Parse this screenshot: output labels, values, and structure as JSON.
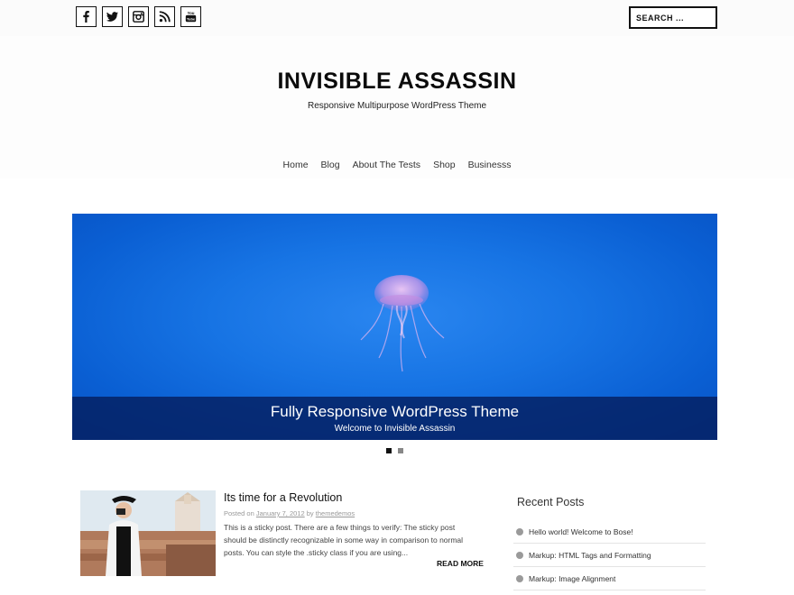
{
  "social": [
    {
      "icon": "facebook-icon",
      "glyph": "f"
    },
    {
      "icon": "twitter-icon",
      "glyph": "t"
    },
    {
      "icon": "instagram-icon",
      "glyph": "i"
    },
    {
      "icon": "rss-icon",
      "glyph": "r"
    },
    {
      "icon": "youtube-icon",
      "glyph": "y"
    }
  ],
  "search": {
    "placeholder": "SEARCH ..."
  },
  "site": {
    "title": "INVISIBLE ASSASSIN",
    "tagline": "Responsive Multipurpose WordPress Theme"
  },
  "nav": {
    "items": [
      {
        "label": "Home"
      },
      {
        "label": "Blog"
      },
      {
        "label": "About The Tests"
      },
      {
        "label": "Shop"
      },
      {
        "label": "Businesss"
      }
    ]
  },
  "slider": {
    "title": "Fully Responsive WordPress Theme",
    "subtitle": "Welcome to Invisible Assassin",
    "slide_count": 2,
    "active_slide": 1
  },
  "post": {
    "title": "Its time for a Revolution",
    "posted_on": "Posted on",
    "date": "January 7, 2012",
    "by": "by",
    "author": "themedemos",
    "excerpt": "This is a sticky post. There are a few things to verify: The sticky post should be distinctly recognizable in some way in comparison to normal posts. You can style the .sticky class if you are using...",
    "read_more": "READ MORE"
  },
  "sidebar": {
    "title": "Recent Posts",
    "items": [
      {
        "label": "Hello world! Welcome to Bose!"
      },
      {
        "label": "Markup: HTML Tags and Formatting"
      },
      {
        "label": "Markup: Image Alignment"
      }
    ]
  },
  "colors": {
    "slider_blue": "#1774e4",
    "caption_bg": "#051e5f",
    "text_dark": "#111111"
  }
}
